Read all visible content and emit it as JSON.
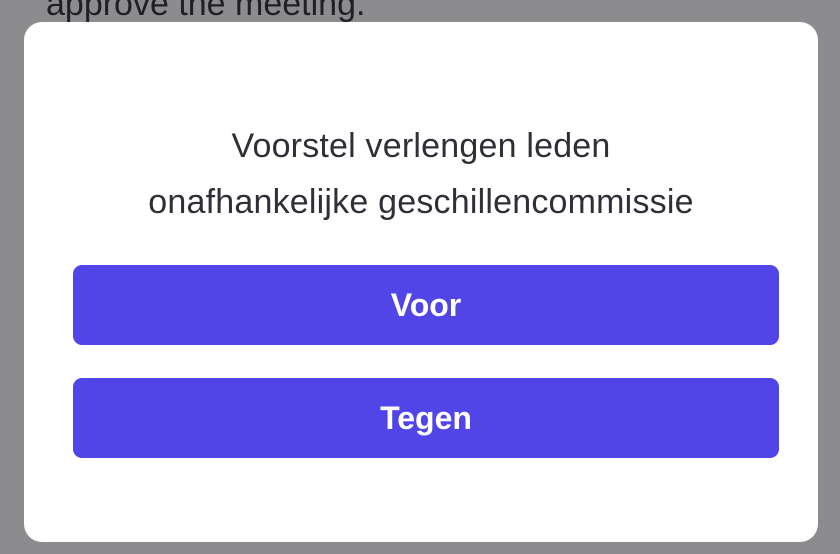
{
  "background_text": "approve the meeting.",
  "dialog": {
    "title_line1": "Voorstel verlengen leden",
    "title_line2": "onafhankelijke geschillencommissie",
    "buttons": {
      "for_label": "Voor",
      "against_label": "Tegen"
    }
  },
  "colors": {
    "backdrop": "#8c8c8f",
    "dialog_bg": "#ffffff",
    "button_bg": "#5145e8",
    "button_text": "#ffffff",
    "title_text": "#2f3037"
  }
}
